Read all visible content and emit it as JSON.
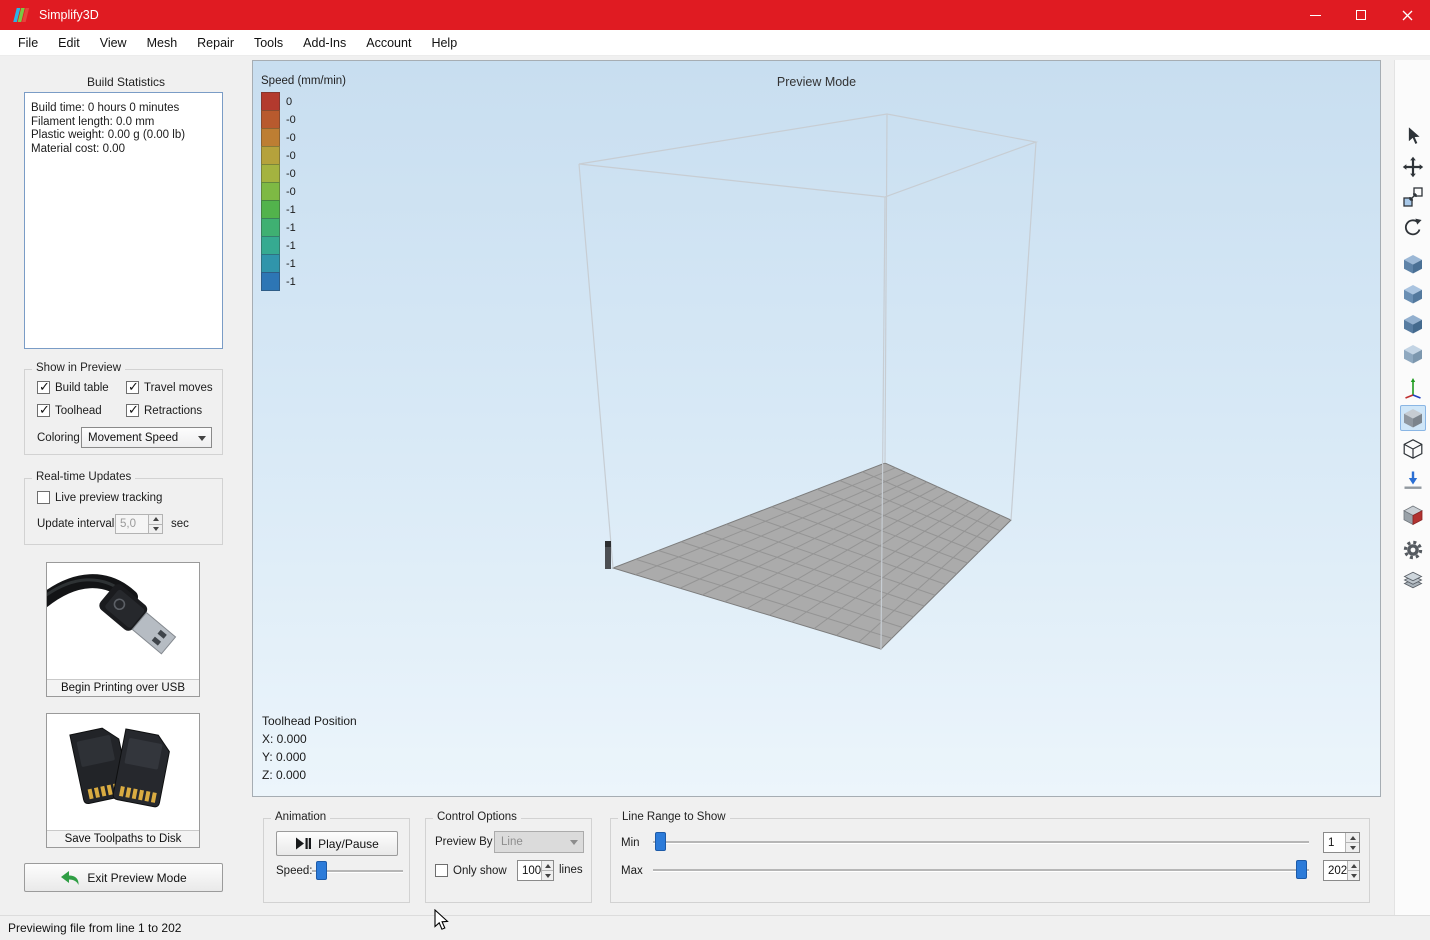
{
  "colors": {
    "titlebar_red": "#e01b22",
    "accent_blue": "#2c7bd9",
    "selected_tool_bg": "#cfe6f8",
    "build_stats_border": "#7a9cc6"
  },
  "window": {
    "title": "Simplify3D"
  },
  "menu_bar": {
    "items": [
      "File",
      "Edit",
      "View",
      "Mesh",
      "Repair",
      "Tools",
      "Add-Ins",
      "Account",
      "Help"
    ]
  },
  "sidebar": {
    "build_statistics": {
      "title": "Build Statistics",
      "stats": [
        "Build time: 0 hours 0 minutes",
        "Filament length: 0.0 mm",
        "Plastic weight: 0.00 g (0.00 lb)",
        "Material cost: 0.00"
      ]
    },
    "show_in_preview": {
      "title": "Show in Preview",
      "checkboxes": [
        {
          "label": "Build table",
          "checked": true
        },
        {
          "label": "Travel moves",
          "checked": true
        },
        {
          "label": "Toolhead",
          "checked": true
        },
        {
          "label": "Retractions",
          "checked": true
        }
      ],
      "coloring_label": "Coloring",
      "coloring_value": "Movement Speed"
    },
    "realtime_updates": {
      "title": "Real-time Updates",
      "live_preview": {
        "label": "Live preview tracking",
        "checked": false
      },
      "update_interval_label": "Update interval",
      "update_interval_value": "5,0",
      "update_interval_unit": "sec"
    },
    "usb_panel": {
      "image": "usb-cable-photo",
      "button_label": "Begin Printing over USB"
    },
    "disk_panel": {
      "image": "sd-cards-photo",
      "button_label": "Save Toolpaths to Disk"
    },
    "exit_button_label": "Exit Preview Mode"
  },
  "viewport": {
    "mode_label": "Preview Mode",
    "legend": {
      "title": "Speed (mm/min)",
      "entries": [
        {
          "color": "#b33a2e",
          "label": "0"
        },
        {
          "color": "#b85a2e",
          "label": "-0"
        },
        {
          "color": "#bd7e33",
          "label": "-0"
        },
        {
          "color": "#b5a23c",
          "label": "-0"
        },
        {
          "color": "#a4b340",
          "label": "-0"
        },
        {
          "color": "#7eb944",
          "label": "-0"
        },
        {
          "color": "#52b34c",
          "label": "-1"
        },
        {
          "color": "#3fb072",
          "label": "-1"
        },
        {
          "color": "#36aa91",
          "label": "-1"
        },
        {
          "color": "#3095ab",
          "label": "-1"
        },
        {
          "color": "#2d76b5",
          "label": "-1"
        }
      ]
    },
    "toolhead_position": {
      "title": "Toolhead Position",
      "x": "X: 0.000",
      "y": "Y: 0.000",
      "z": "Z: 0.000"
    }
  },
  "bottom_panel": {
    "animation": {
      "title": "Animation",
      "play_pause_label": "Play/Pause",
      "speed_label": "Speed:"
    },
    "control_options": {
      "title": "Control Options",
      "preview_by_label": "Preview By",
      "preview_by_value": "Line",
      "only_show": {
        "label": "Only show",
        "checked": false
      },
      "only_show_value": "100",
      "lines_label": "lines"
    },
    "line_range": {
      "title": "Line Range to Show",
      "min_label": "Min",
      "min_value": "1",
      "max_label": "Max",
      "max_value": "202"
    }
  },
  "right_toolbar": {
    "tools": [
      {
        "name": "select"
      },
      {
        "name": "move-model"
      },
      {
        "name": "scale-model"
      },
      {
        "name": "rotate-model"
      },
      {
        "name": "view-cube-1"
      },
      {
        "name": "view-cube-2"
      },
      {
        "name": "view-cube-3"
      },
      {
        "name": "view-cube-4"
      },
      {
        "name": "coordinate-axes"
      },
      {
        "name": "solid-view",
        "selected": true
      },
      {
        "name": "wireframe-view"
      },
      {
        "name": "place-on-bed"
      },
      {
        "name": "cross-section"
      },
      {
        "name": "settings-gear"
      },
      {
        "name": "layers"
      }
    ]
  },
  "status_bar": {
    "text": "Previewing file from line 1 to 202"
  }
}
